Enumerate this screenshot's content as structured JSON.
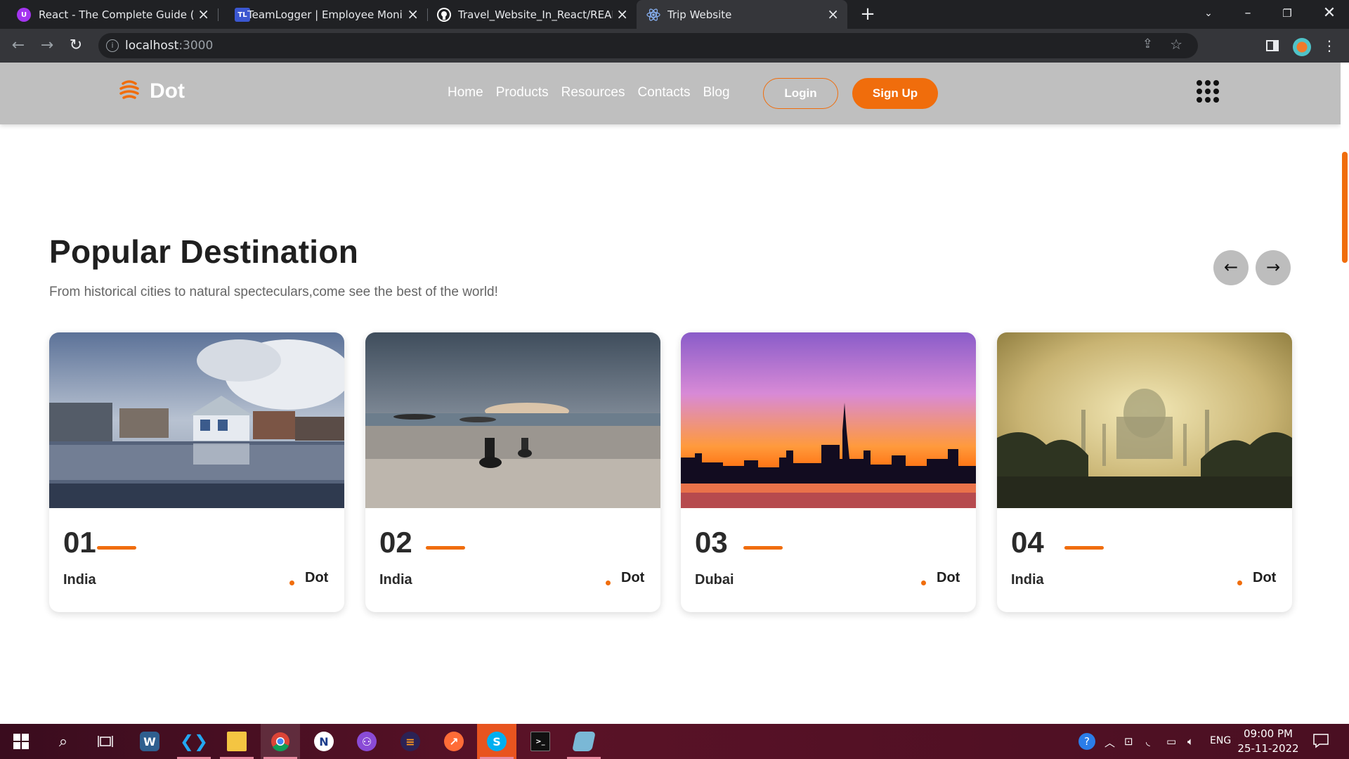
{
  "browser": {
    "tabs": [
      {
        "title": "React - The Complete Guide (incl",
        "favicon": "U",
        "favicon_color": "#a435f0"
      },
      {
        "title": "TeamLogger | Employee Monitori",
        "favicon": "TL",
        "favicon_color": "#3b57d1"
      },
      {
        "title": "Travel_Website_In_React/README",
        "favicon": "github-icon",
        "favicon_color": "#ffffff"
      },
      {
        "title": "Trip Website",
        "favicon": "react-icon",
        "favicon_color": "#61dafb"
      }
    ],
    "url_host": "localhost",
    "url_port": ":3000"
  },
  "site": {
    "logo": "Dot",
    "nav": [
      "Home",
      "Products",
      "Resources",
      "Contacts",
      "Blog"
    ],
    "login": "Login",
    "signup": "Sign Up",
    "accent": "#f06d0c"
  },
  "section": {
    "title": "Popular Destination",
    "subtitle": "From historical cities to natural specteculars,come see the best of the world!"
  },
  "cards": [
    {
      "num": "01",
      "place": "India",
      "brand": "Dot",
      "image": "lakeside-houses-photo"
    },
    {
      "num": "02",
      "place": "India",
      "brand": "Dot",
      "image": "beach-sunset-bikers-photo"
    },
    {
      "num": "03",
      "place": "Dubai",
      "brand": "Dot",
      "image": "dubai-skyline-sunset-photo"
    },
    {
      "num": "04",
      "place": "India",
      "brand": "Dot",
      "image": "taj-mahal-mist-photo"
    }
  ],
  "taskbar": {
    "language": "ENG",
    "time": "09:00 PM",
    "date": "25-11-2022"
  }
}
